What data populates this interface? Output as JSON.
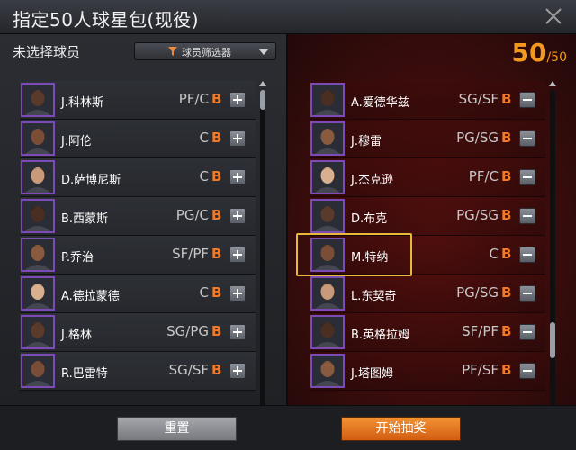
{
  "window": {
    "title": "指定50人球星包(现役)"
  },
  "left": {
    "label": "未选择球员",
    "filter": {
      "label": "球员筛选器",
      "icon": "funnel-icon"
    },
    "players": [
      {
        "name": "J.科林斯",
        "pos": "PF/C",
        "grade": "B",
        "action": "+"
      },
      {
        "name": "J.阿伦",
        "pos": "C",
        "grade": "B",
        "action": "+"
      },
      {
        "name": "D.萨博尼斯",
        "pos": "C",
        "grade": "B",
        "action": "+"
      },
      {
        "name": "B.西蒙斯",
        "pos": "PG/C",
        "grade": "B",
        "action": "+"
      },
      {
        "name": "P.乔治",
        "pos": "SF/PF",
        "grade": "B",
        "action": "+"
      },
      {
        "name": "A.德拉蒙德",
        "pos": "C",
        "grade": "B",
        "action": "+"
      },
      {
        "name": "J.格林",
        "pos": "SG/PG",
        "grade": "B",
        "action": "+"
      },
      {
        "name": "R.巴雷特",
        "pos": "SG/SF",
        "grade": "B",
        "action": "+"
      }
    ]
  },
  "right": {
    "count": "50",
    "total": "/50",
    "players": [
      {
        "name": "A.爱德华兹",
        "pos": "SG/SF",
        "grade": "B",
        "action": "−"
      },
      {
        "name": "J.穆雷",
        "pos": "PG/SG",
        "grade": "B",
        "action": "−"
      },
      {
        "name": "J.杰克逊",
        "pos": "PF/C",
        "grade": "B",
        "action": "−"
      },
      {
        "name": "D.布克",
        "pos": "PG/SG",
        "grade": "B",
        "action": "−"
      },
      {
        "name": "M.特纳",
        "pos": "C",
        "grade": "B",
        "action": "−"
      },
      {
        "name": "L.东契奇",
        "pos": "PG/SG",
        "grade": "B",
        "action": "−"
      },
      {
        "name": "B.英格拉姆",
        "pos": "SF/PF",
        "grade": "B",
        "action": "−"
      },
      {
        "name": "J.塔图姆",
        "pos": "PF/SF",
        "grade": "B",
        "action": "−"
      }
    ],
    "highlighted_index": 4
  },
  "footer": {
    "reset_label": "重置",
    "start_label": "开始抽奖"
  },
  "colors": {
    "accent_orange": "#f29a1e",
    "grade": "#f07a28",
    "highlight": "#e8b83a",
    "avatar_border": "#7c4bb6"
  }
}
